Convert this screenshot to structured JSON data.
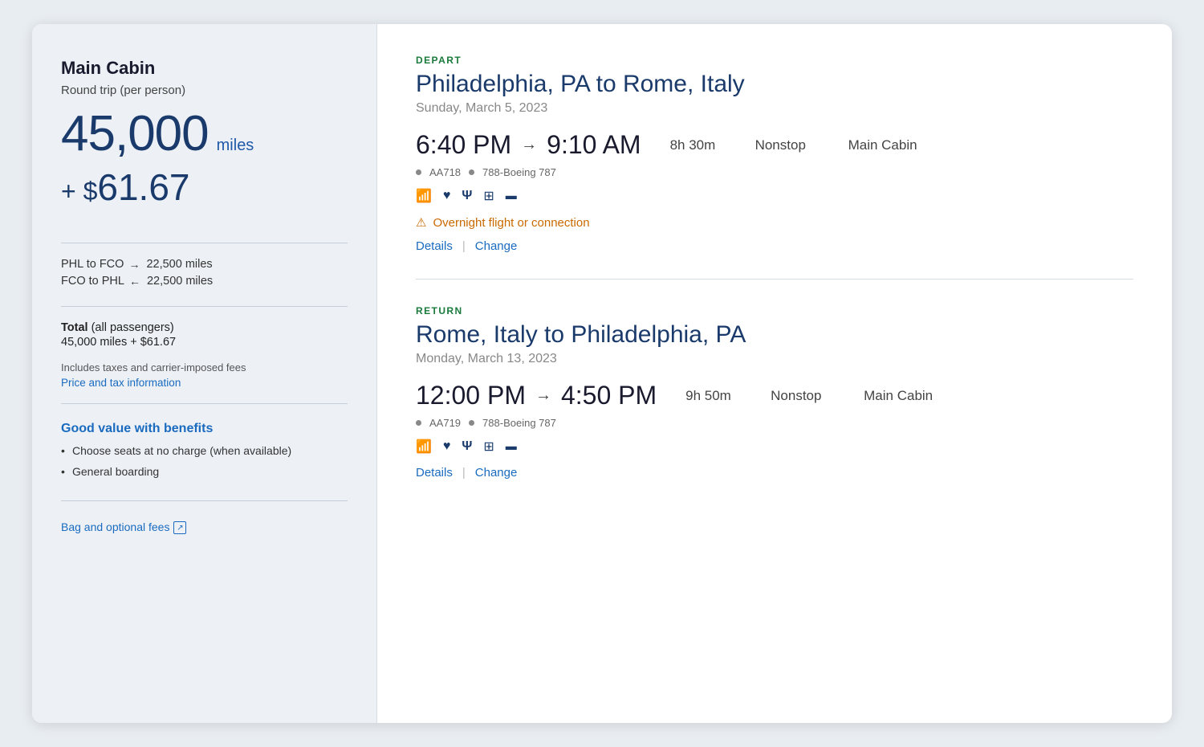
{
  "sidebar": {
    "title": "Main Cabin",
    "subtitle": "Round trip (per person)",
    "miles_number": "45,000",
    "miles_label": "miles",
    "cash_prefix": "+ $",
    "cash_amount": "61.67",
    "route1_from": "PHL to FCO",
    "route1_arrow": "→",
    "route1_miles": "22,500 miles",
    "route2_from": "FCO to PHL",
    "route2_arrow": "←",
    "route2_miles": "22,500 miles",
    "total_label_bold": "Total",
    "total_label_rest": " (all passengers)",
    "total_value": "45,000 miles + $61.67",
    "taxes_note": "Includes taxes and carrier-imposed fees",
    "price_tax_link": "Price and tax information",
    "good_value_title": "Good value with benefits",
    "benefit1": "Choose seats at no charge (when available)",
    "benefit2": "General boarding",
    "bag_fees_link": "Bag and optional fees"
  },
  "depart": {
    "section_label": "DEPART",
    "route": "Philadelphia, PA to Rome, Italy",
    "date": "Sunday, March 5, 2023",
    "depart_time": "6:40 PM",
    "arrive_time": "9:10 AM",
    "duration": "8h 30m",
    "nonstop": "Nonstop",
    "cabin": "Main Cabin",
    "flight_number": "AA718",
    "aircraft": "788-Boeing 787",
    "overnight_warning": "Overnight flight or connection",
    "details_link": "Details",
    "change_link": "Change"
  },
  "return": {
    "section_label": "RETURN",
    "route": "Rome, Italy to Philadelphia, PA",
    "date": "Monday, March 13, 2023",
    "depart_time": "12:00 PM",
    "arrive_time": "4:50 PM",
    "duration": "9h 50m",
    "nonstop": "Nonstop",
    "cabin": "Main Cabin",
    "flight_number": "AA719",
    "aircraft": "788-Boeing 787",
    "details_link": "Details",
    "change_link": "Change"
  },
  "colors": {
    "accent_blue": "#1a6bbf",
    "dark_blue": "#1a3a6b",
    "green": "#1a7a3c",
    "orange": "#c96a00"
  }
}
